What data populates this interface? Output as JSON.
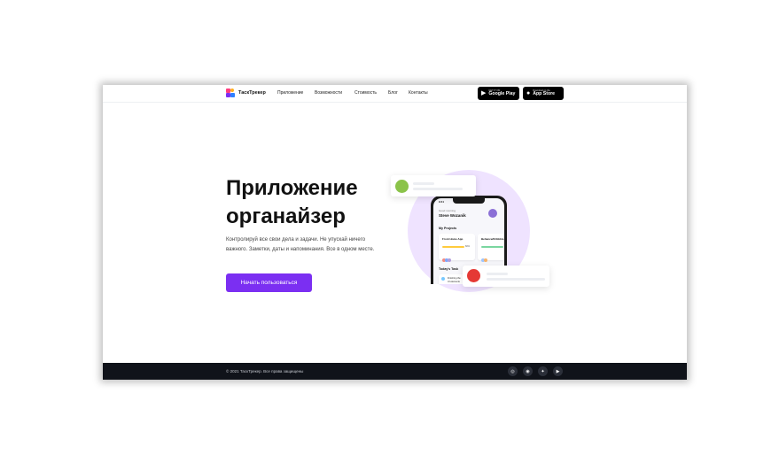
{
  "header": {
    "brand": "ТаскТрекер",
    "nav": [
      "Приложение",
      "Возможности",
      "Стоимость",
      "Блог",
      "Контакты"
    ],
    "google_play": {
      "small": "GET IT ON",
      "big": "Google Play",
      "icon": "google-play-icon"
    },
    "app_store": {
      "small": "Download on the",
      "big": "App Store",
      "icon": "apple-icon"
    }
  },
  "hero": {
    "title_line1": "Приложение",
    "title_line2": "органайзер",
    "lead": "Контролируй все свои дела и задачи. Не упускай ничего важного. Заметки, даты и напоминания. Все в одном месте.",
    "cta": "Начать пользоваться"
  },
  "phone": {
    "time": "9:41",
    "greeting": "Good morning",
    "name": "Steve Wozanik",
    "projects_title": "My Projects",
    "project1": {
      "title": "Front Home App",
      "percent": "60%"
    },
    "project2": {
      "title": "Behance/Dribbble"
    },
    "tasks_title": "Today's Task",
    "task_line1": "Finishing the",
    "task_line2": "UI elements"
  },
  "footer": {
    "copyright": "© 2021 ТаскТрекер. Все права защищены",
    "social": [
      "instagram-icon",
      "dribbble-icon",
      "twitter-icon",
      "youtube-icon"
    ]
  },
  "colors": {
    "accent": "#7b2ff2",
    "footer_bg": "#10131a",
    "blob": "#efe3ff"
  }
}
